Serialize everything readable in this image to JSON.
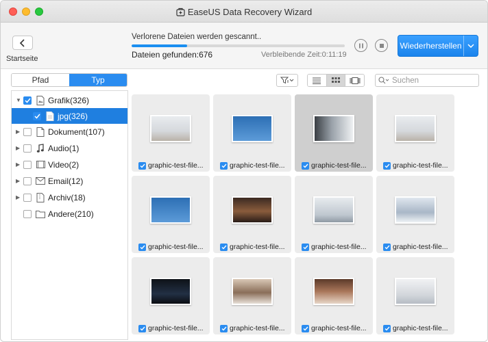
{
  "window": {
    "title": "EaseUS Data Recovery Wizard"
  },
  "toolbar": {
    "back_label": "Startseite",
    "scan_status": "Verlorene Dateien werden gescannt..",
    "progress_percent": 26,
    "files_found": "Dateien gefunden:676",
    "remaining_time": "Verbleibende Zeit:0:11:19",
    "restore_label": "Wiederherstellen"
  },
  "tabs": [
    {
      "label": "Pfad",
      "active": false
    },
    {
      "label": "Typ",
      "active": true
    }
  ],
  "search": {
    "placeholder": "Suchen"
  },
  "tree": [
    {
      "label": "Grafik(326)",
      "icon": "image-file-icon",
      "expanded": true,
      "checked": true,
      "level": 0
    },
    {
      "label": "jpg(326)",
      "icon": "file-icon",
      "checked": true,
      "level": 1,
      "selected": true
    },
    {
      "label": "Dokument(107)",
      "icon": "document-icon",
      "checked": false,
      "level": 0
    },
    {
      "label": "Audio(1)",
      "icon": "music-note-icon",
      "checked": false,
      "level": 0
    },
    {
      "label": "Video(2)",
      "icon": "video-icon",
      "checked": false,
      "level": 0
    },
    {
      "label": "Email(12)",
      "icon": "envelope-icon",
      "checked": false,
      "level": 0
    },
    {
      "label": "Archiv(18)",
      "icon": "archive-icon",
      "checked": false,
      "level": 0
    },
    {
      "label": "Andere(210)",
      "icon": "folder-icon",
      "checked": false,
      "level": 0,
      "no_expander": true
    }
  ],
  "files": [
    {
      "label": "graphic-test-file...",
      "checked": true,
      "thumb": "family-couch"
    },
    {
      "label": "graphic-test-file...",
      "checked": true,
      "thumb": "sky-birds"
    },
    {
      "label": "graphic-test-file...",
      "checked": true,
      "thumb": "office-desk",
      "highlighted": true
    },
    {
      "label": "graphic-test-file...",
      "checked": true,
      "thumb": "family-couch"
    },
    {
      "label": "graphic-test-file...",
      "checked": true,
      "thumb": "sky-birds"
    },
    {
      "label": "graphic-test-file...",
      "checked": true,
      "thumb": "man-laptop-night"
    },
    {
      "label": "graphic-test-file...",
      "checked": true,
      "thumb": "meeting-room"
    },
    {
      "label": "graphic-test-file...",
      "checked": true,
      "thumb": "business-meeting"
    },
    {
      "label": "graphic-test-file...",
      "checked": true,
      "thumb": "dark-stage"
    },
    {
      "label": "graphic-test-file...",
      "checked": true,
      "thumb": "team-table"
    },
    {
      "label": "graphic-test-file...",
      "checked": true,
      "thumb": "hands-notebook"
    },
    {
      "label": "graphic-test-file...",
      "checked": true,
      "thumb": "woman-desk"
    }
  ],
  "colors": {
    "accent": "#2a8cf0",
    "selection": "#1f7fe0"
  }
}
